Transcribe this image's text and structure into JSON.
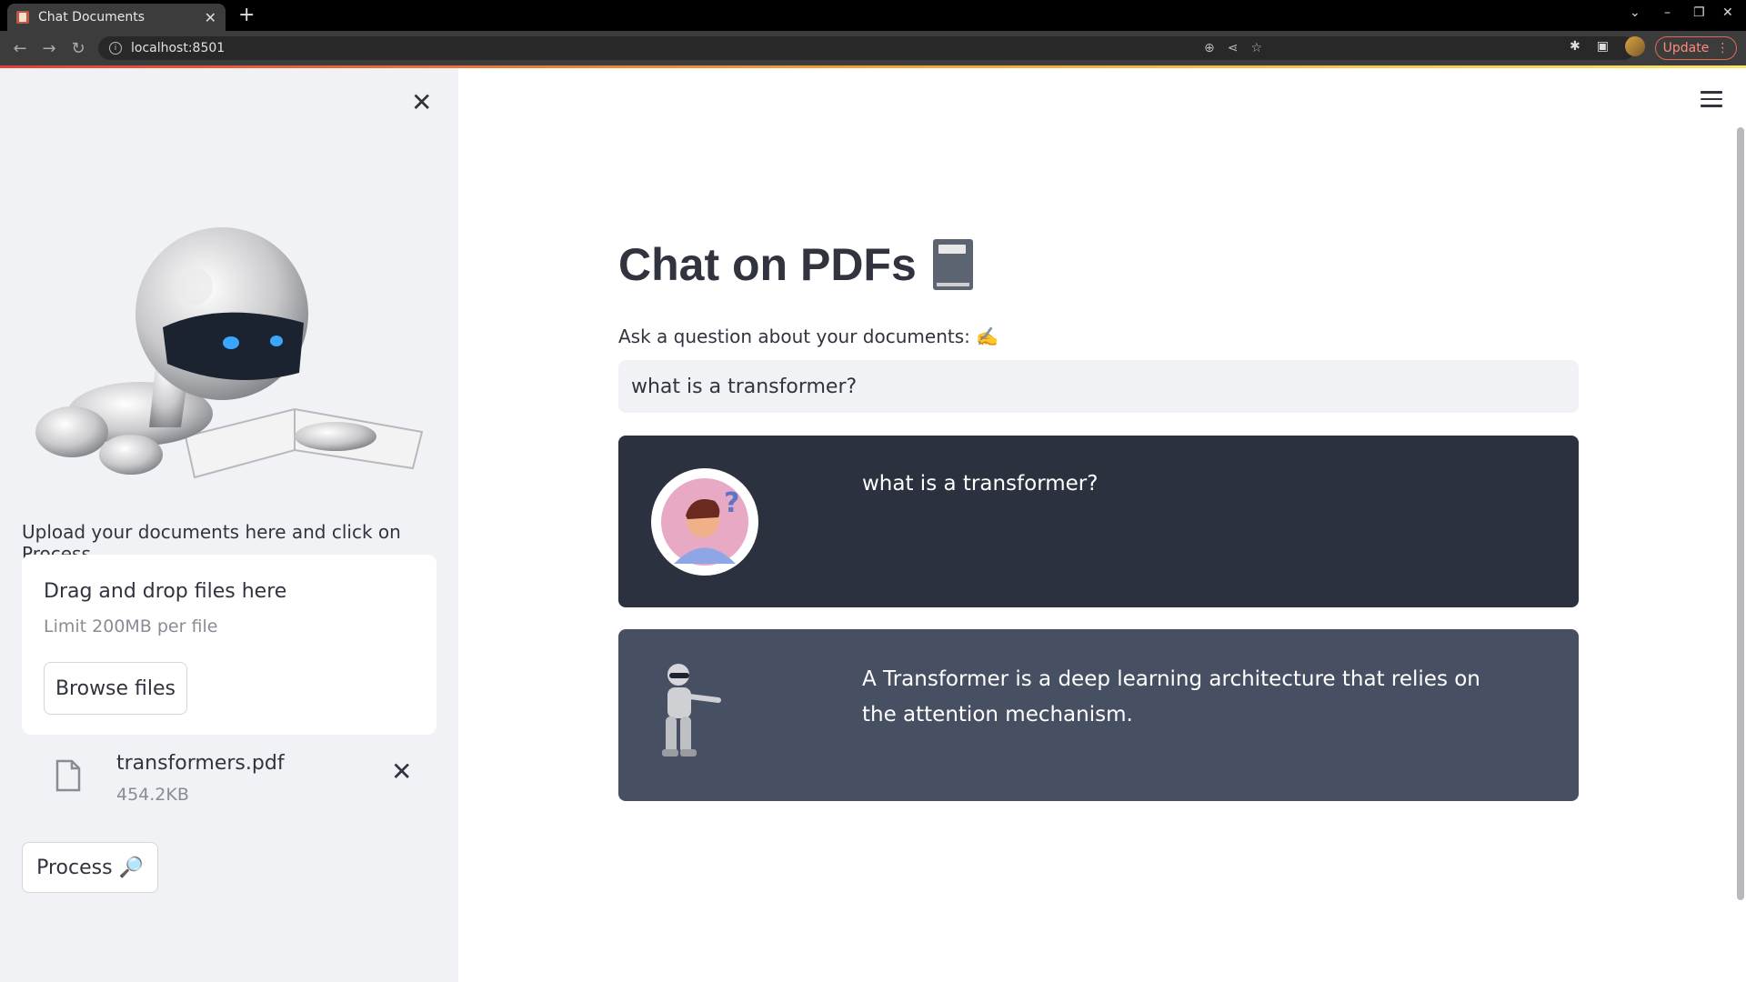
{
  "browser": {
    "tab_title": "Chat Documents",
    "url": "localhost:8501",
    "update_label": "Update"
  },
  "sidebar": {
    "upload_label": "Upload your documents here and click on Process",
    "dropzone_title": "Drag and drop files here",
    "dropzone_limit": "Limit 200MB per file",
    "browse_label": "Browse files",
    "file": {
      "name": "transformers.pdf",
      "size": "454.2KB"
    },
    "process_label": "Process 🔎"
  },
  "main": {
    "title": "Chat on PDFs",
    "question_label": "Ask a question about your documents: ✍️",
    "question_value": "what is a transformer?",
    "messages": [
      {
        "role": "user",
        "text": "what is a transformer?"
      },
      {
        "role": "bot",
        "text": "A Transformer is a deep learning architecture that relies on the attention mechanism."
      }
    ]
  },
  "colors": {
    "user_bubble": "#2b313e",
    "bot_bubble": "#475063",
    "sidebar_bg": "#f0f2f6",
    "text": "#31333f"
  }
}
